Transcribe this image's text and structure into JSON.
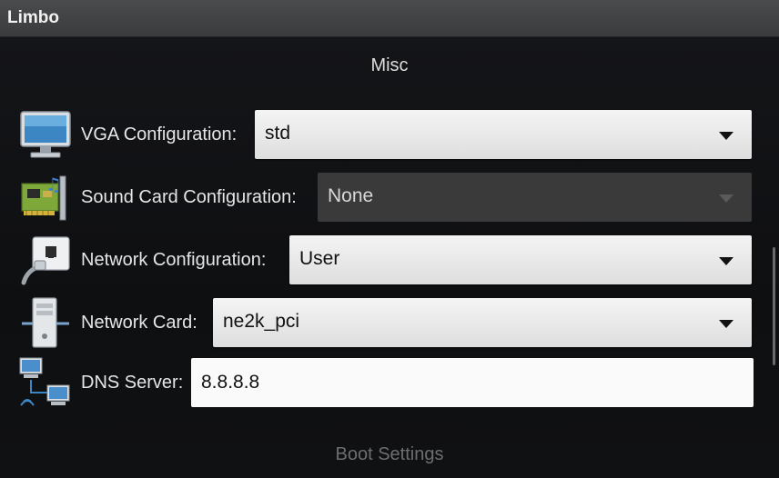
{
  "app": {
    "title": "Limbo"
  },
  "sections": {
    "misc": "Misc",
    "boot": "Boot Settings"
  },
  "settings": {
    "vga": {
      "label": "VGA Configuration:",
      "value": "std",
      "icon": "monitor-icon"
    },
    "sound": {
      "label": "Sound Card Configuration:",
      "value": "None",
      "icon": "sound-card-icon",
      "disabled": true
    },
    "network": {
      "label": "Network Configuration:",
      "value": "User",
      "icon": "network-port-icon"
    },
    "netcard": {
      "label": "Network Card:",
      "value": "ne2k_pci",
      "icon": "computer-tower-icon"
    },
    "dns": {
      "label": "DNS Server:",
      "value": "8.8.8.8",
      "icon": "network-computers-icon"
    }
  }
}
